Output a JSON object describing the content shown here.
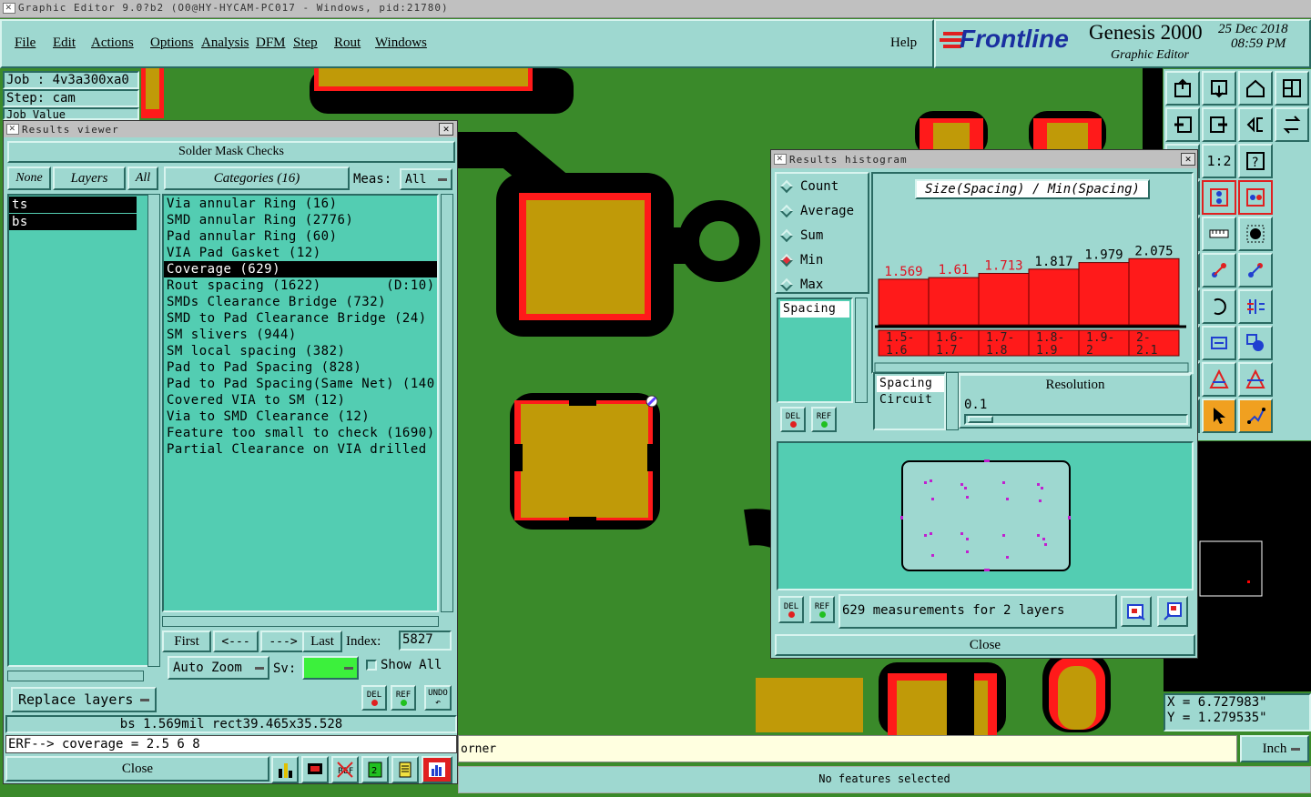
{
  "window_title": "Graphic Editor 9.0?b2 (O0@HY-HYCAM-PC017 - Windows, pid:21780)",
  "menu": [
    "File",
    "Edit",
    "Actions",
    "Options",
    "Analysis",
    "DFM",
    "Step",
    "Rout",
    "Windows"
  ],
  "help": "Help",
  "brand": {
    "logo": "Frontline",
    "product": "Genesis 2000",
    "subtitle": "Graphic Editor",
    "date": "25 Dec 2018",
    "time": "08:59 PM"
  },
  "job": {
    "job_label": "Job : 4v3a300xa0",
    "step_label": "Step: cam",
    "extra_label": "Job Value"
  },
  "results_viewer": {
    "title": "Results viewer",
    "header": "Solder Mask Checks",
    "none_btn": "None",
    "layers_btn": "Layers",
    "all_btn": "All",
    "categories_btn": "Categories (16)",
    "meas_label": "Meas:",
    "meas_value": "All",
    "layers": [
      "ts",
      "bs"
    ],
    "categories": [
      "Via annular Ring (16)",
      "SMD annular Ring (2776)",
      "Pad annular Ring (60)",
      "VIA Pad Gasket (12)",
      "Coverage (629)",
      "Rout spacing (1622)        (D:10)",
      "SMDs Clearance Bridge (732)",
      "SMD to Pad Clearance Bridge (24)",
      "SM slivers (944)",
      "SM local spacing (382)",
      "Pad to Pad Spacing (828)",
      "Pad to Pad Spacing(Same Net) (140",
      "Covered VIA to SM (12)",
      "Via to SMD Clearance (12)",
      "Feature too small to check (1690)",
      "Partial Clearance on VIA drilled"
    ],
    "selected_category": 4,
    "first": "First",
    "prev": "<---",
    "next": "--->",
    "last": "Last",
    "index_label": "Index:",
    "index_value": "5827",
    "auto_zoom": "Auto Zoom",
    "sv_label": "Sv:",
    "show_all": "Show All",
    "replace_layers": "Replace layers",
    "del": "DEL",
    "ref": "REF",
    "undo": "UNDO",
    "status_line": "bs 1.569mil   rect39.465x35.528",
    "erf_line": "ERF--> coverage = 2.5 6 8",
    "close": "Close"
  },
  "histogram": {
    "title": "Results histogram",
    "modes": [
      "Count",
      "Average",
      "Sum",
      "Min",
      "Max"
    ],
    "selected_mode": 3,
    "chart_title": "Size(Spacing) / Min(Spacing)",
    "list_items": [
      "Spacing"
    ],
    "type_items": [
      "Spacing",
      "Circuit"
    ],
    "resolution_label": "Resolution",
    "resolution_value": "0.1",
    "del": "DEL",
    "ref": "REF",
    "measurements": "629 measurements for 2 layers",
    "close": "Close"
  },
  "chart_data": {
    "type": "bar",
    "title": "Size(Spacing) / Min(Spacing)",
    "categories": [
      "1.5-1.6",
      "1.6-1.7",
      "1.7-1.8",
      "1.8-1.9",
      "1.9-2",
      "2-2.1"
    ],
    "category_lines": [
      [
        "1.5-",
        "1.6"
      ],
      [
        "1.6-",
        "1.7"
      ],
      [
        "1.7-",
        "1.8"
      ],
      [
        "1.8-",
        "1.9"
      ],
      [
        "1.9-",
        "2"
      ],
      [
        "2-",
        "2.1"
      ]
    ],
    "values": [
      1.569,
      1.61,
      1.713,
      1.817,
      1.979,
      2.075
    ],
    "value_labels": [
      "1.569",
      "1.61",
      "1.713",
      "1.817",
      "1.979",
      "2.075"
    ],
    "ylim": [
      0,
      2.2
    ]
  },
  "coords": {
    "x": "X = 6.727983\"",
    "y": "Y = 1.279535\""
  },
  "prompt_text": "orner",
  "units": "Inch",
  "status": "No features selected",
  "colors": {
    "board": "#3a8a2a",
    "pad": "#c09a08",
    "mask_edge": "#ff1a1a",
    "panel": "#9ed8d0",
    "list": "#53cdb2"
  }
}
